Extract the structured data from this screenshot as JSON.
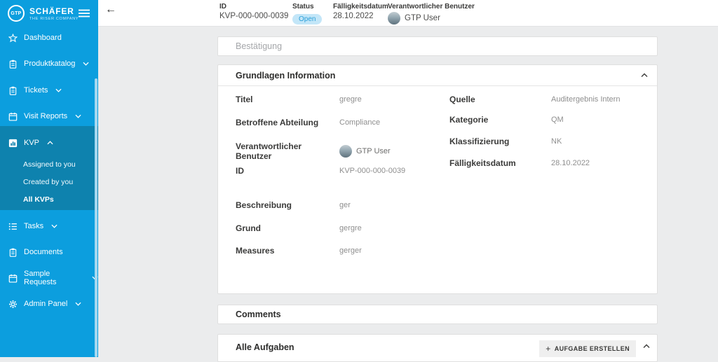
{
  "colors": {
    "sidebar_bg": "#0C9EDE",
    "sidebar_active_bg": "#0E82AE",
    "content_bg": "#EBECED",
    "status_badge_bg": "#C3E6F8",
    "status_badge_text": "#2B9FD8"
  },
  "sidebar": {
    "logo_text": "GTP",
    "brand": "SCHÄFER",
    "tagline": "THE RISER COMPANY",
    "items": [
      {
        "label": "Dashboard",
        "icon": "star"
      },
      {
        "label": "Produktkatalog",
        "icon": "clipboard",
        "chevron": "down"
      },
      {
        "label": "Tickets",
        "icon": "clipboard",
        "chevron": "down"
      },
      {
        "label": "Visit Reports",
        "icon": "calendar",
        "chevron": "down"
      },
      {
        "label": "KVP",
        "icon": "bar-chart",
        "chevron": "up",
        "expanded": true
      },
      {
        "label": "Tasks",
        "icon": "list",
        "chevron": "down"
      },
      {
        "label": "Documents",
        "icon": "clipboard"
      },
      {
        "label": "Sample Requests",
        "icon": "calendar",
        "chevron": "down"
      },
      {
        "label": "Admin Panel",
        "icon": "gear",
        "chevron": "down"
      }
    ],
    "kvp_children": [
      {
        "label": "Assigned to you",
        "active": false
      },
      {
        "label": "Created by you",
        "active": false
      },
      {
        "label": "All KVPs",
        "active": true
      }
    ]
  },
  "header": {
    "id": {
      "label": "ID",
      "value": "KVP-000-000-0039"
    },
    "status": {
      "label": "Status",
      "value": "Open"
    },
    "due": {
      "label": "Fälligkeitsdatum",
      "value": "28.10.2022"
    },
    "owner": {
      "label": "Verantwortlicher Benutzer",
      "value": "GTP User"
    }
  },
  "sections": {
    "confirmation": {
      "title": "Bestätigung"
    },
    "basics": {
      "title": "Grundlagen Information",
      "left": [
        {
          "label": "Titel",
          "value": "gregre"
        },
        {
          "label": "Betroffene Abteilung",
          "value": "Compliance"
        },
        {
          "label": "Verantwortlicher Benutzer",
          "value": "GTP User"
        },
        {
          "label": "ID",
          "value": "KVP-000-000-0039"
        },
        {
          "label": "Beschreibung",
          "value": "ger"
        },
        {
          "label": "Grund",
          "value": "gergre"
        },
        {
          "label": "Measures",
          "value": "gerger"
        }
      ],
      "right": [
        {
          "label": "Quelle",
          "value": "Auditergebnis Intern"
        },
        {
          "label": "Kategorie",
          "value": "QM"
        },
        {
          "label": "Klassifizierung",
          "value": "NK"
        },
        {
          "label": "Fälligkeitsdatum",
          "value": "28.10.2022"
        }
      ]
    },
    "comments": {
      "title": "Comments"
    },
    "tasks": {
      "title": "Alle Aufgaben",
      "create_plus": "+",
      "create_label": "AUFGABE ERSTELLEN"
    }
  }
}
